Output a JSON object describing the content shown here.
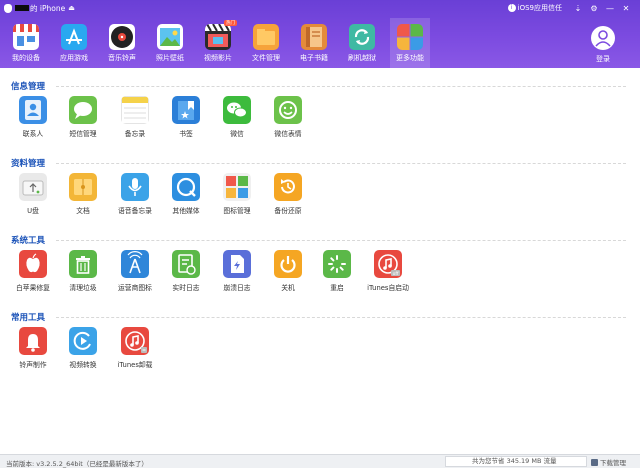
{
  "titlebar": {
    "device_name": "的 iPhone",
    "eject_glyph": "⏏",
    "trust_label": "iOS9应用信任",
    "trust_icon": "info-icon",
    "controls": [
      "⇣",
      "⚙",
      "—",
      "✕"
    ]
  },
  "nav": {
    "items": [
      {
        "label": "我的设备",
        "icon": "store-icon",
        "badge": ""
      },
      {
        "label": "应用游戏",
        "icon": "app-store-icon",
        "badge": ""
      },
      {
        "label": "音乐铃声",
        "icon": "music-disc-icon",
        "badge": ""
      },
      {
        "label": "照片壁纸",
        "icon": "photo-icon",
        "badge": ""
      },
      {
        "label": "视频影片",
        "icon": "video-icon",
        "badge": "热门"
      },
      {
        "label": "文件管理",
        "icon": "folder-icon",
        "badge": ""
      },
      {
        "label": "电子书籍",
        "icon": "book-icon",
        "badge": ""
      },
      {
        "label": "刷机越狱",
        "icon": "refresh-icon",
        "badge": ""
      },
      {
        "label": "更多功能",
        "icon": "more-grid-icon",
        "badge": ""
      }
    ],
    "active_index": 8,
    "login_label": "登录"
  },
  "sections": [
    {
      "title": "信息管理",
      "items": [
        {
          "label": "联系人",
          "icon": "contacts-icon",
          "color": "#3b8fe6"
        },
        {
          "label": "短信管理",
          "icon": "sms-icon",
          "color": "#6cc24a"
        },
        {
          "label": "备忘录",
          "icon": "notes-icon",
          "color": "#f5d24a"
        },
        {
          "label": "书签",
          "icon": "bookmark-icon",
          "color": "#2b7fd8"
        },
        {
          "label": "微信",
          "icon": "wechat-icon",
          "color": "#3dbb3d"
        },
        {
          "label": "微信表情",
          "icon": "emoji-icon",
          "color": "#6cc24a"
        }
      ]
    },
    {
      "title": "资料管理",
      "items": [
        {
          "label": "U盘",
          "icon": "usb-icon",
          "color": "#e9e9e9"
        },
        {
          "label": "文档",
          "icon": "document-icon",
          "color": "#f3b637"
        },
        {
          "label": "语音备忘录",
          "icon": "microphone-icon",
          "color": "#3ba3e8"
        },
        {
          "label": "其他媒体",
          "icon": "media-icon",
          "color": "#2d8fe0"
        },
        {
          "label": "图标管理",
          "icon": "icon-manage-icon",
          "color": "#f0f0f0"
        },
        {
          "label": "备份还原",
          "icon": "backup-icon",
          "color": "#f5a623"
        }
      ]
    },
    {
      "title": "系统工具",
      "items": [
        {
          "label": "白苹果修复",
          "icon": "apple-fix-icon",
          "color": "#e8493f"
        },
        {
          "label": "清理垃圾",
          "icon": "trash-icon",
          "color": "#5bb848"
        },
        {
          "label": "运营商图标",
          "icon": "antenna-icon",
          "color": "#2f86d9"
        },
        {
          "label": "实时日志",
          "icon": "log-icon",
          "color": "#5bb848"
        },
        {
          "label": "崩溃日志",
          "icon": "crash-log-icon",
          "color": "#2f86d9"
        },
        {
          "label": "关机",
          "icon": "power-icon",
          "color": "#f5a623"
        },
        {
          "label": "重启",
          "icon": "restart-icon",
          "color": "#5bb848"
        },
        {
          "label": "iTunes自启动",
          "icon": "itunes-off-icon",
          "color": "#e8493f"
        }
      ]
    },
    {
      "title": "常用工具",
      "items": [
        {
          "label": "铃声制作",
          "icon": "bell-icon",
          "color": "#e8493f"
        },
        {
          "label": "视频转换",
          "icon": "video-convert-icon",
          "color": "#3ba3e8"
        },
        {
          "label": "iTunes卸载",
          "icon": "itunes-uninstall-icon",
          "color": "#e8493f"
        }
      ]
    }
  ],
  "status": {
    "version": "当前版本: v3.2.5.2_64bit（已经是最新版本了）",
    "traffic": "共为您节省  345.19 MB 流量",
    "download": "下载管理"
  },
  "colors": {
    "header": "#7c4be0",
    "section_title": "#1a52b8"
  }
}
